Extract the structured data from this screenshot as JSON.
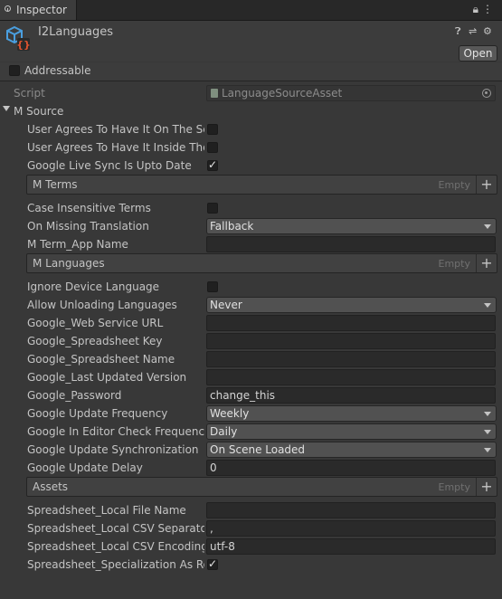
{
  "window": {
    "tab_label": "Inspector"
  },
  "header": {
    "title": "I2Languages",
    "open_label": "Open"
  },
  "addressable": {
    "label": "Addressable",
    "checked": false
  },
  "script_row": {
    "label": "Script",
    "value": "LanguageSourceAsset"
  },
  "section": {
    "label": "M Source"
  },
  "fields": {
    "agree_scene": {
      "label": "User Agrees To Have It On The Sce",
      "checked": false
    },
    "agree_inside": {
      "label": "User Agrees To Have It Inside The F",
      "checked": false
    },
    "live_sync": {
      "label": "Google Live Sync Is Upto Date",
      "checked": true
    },
    "case_insensitive": {
      "label": "Case Insensitive Terms",
      "checked": false
    },
    "missing_translation": {
      "label": "On Missing Translation",
      "value": "Fallback"
    },
    "term_app_name": {
      "label": "M Term_App Name",
      "value": ""
    },
    "ignore_device_lang": {
      "label": "Ignore Device Language",
      "checked": false
    },
    "allow_unloading": {
      "label": "Allow Unloading Languages",
      "value": "Never"
    },
    "web_service_url": {
      "label": "Google_Web Service URL",
      "value": ""
    },
    "spreadsheet_key": {
      "label": "Google_Spreadsheet Key",
      "value": ""
    },
    "spreadsheet_name": {
      "label": "Google_Spreadsheet Name",
      "value": ""
    },
    "last_updated_version": {
      "label": "Google_Last Updated Version",
      "value": ""
    },
    "password": {
      "label": "Google_Password",
      "value": "change_this"
    },
    "update_frequency": {
      "label": "Google Update Frequency",
      "value": "Weekly"
    },
    "editor_check_frequency": {
      "label": "Google In Editor Check Frequency",
      "value": "Daily"
    },
    "update_sync": {
      "label": "Google Update Synchronization",
      "value": "On Scene Loaded"
    },
    "update_delay": {
      "label": "Google Update Delay",
      "value": "0"
    },
    "local_file_name": {
      "label": "Spreadsheet_Local File Name",
      "value": ""
    },
    "csv_separator": {
      "label": "Spreadsheet_Local CSV Separator",
      "value": ","
    },
    "csv_encoding": {
      "label": "Spreadsheet_Local CSV Encoding",
      "value": "utf-8"
    },
    "specialization_rows": {
      "label": "Spreadsheet_Specialization As Rov",
      "checked": true
    }
  },
  "lists": {
    "terms": {
      "title": "M Terms",
      "empty": "Empty"
    },
    "languages": {
      "title": "M Languages",
      "empty": "Empty"
    },
    "assets": {
      "title": "Assets",
      "empty": "Empty"
    }
  },
  "icons": {
    "asset": "cube-braces-icon",
    "help": "help-icon",
    "settings": "settings-icon",
    "preset": "sliders-icon",
    "lock": "lock-icon",
    "menu": "kebab-menu-icon"
  },
  "colors": {
    "background": "#383838",
    "accent_icon": "#4a9fe0",
    "asset_badge": "#e0542f"
  }
}
